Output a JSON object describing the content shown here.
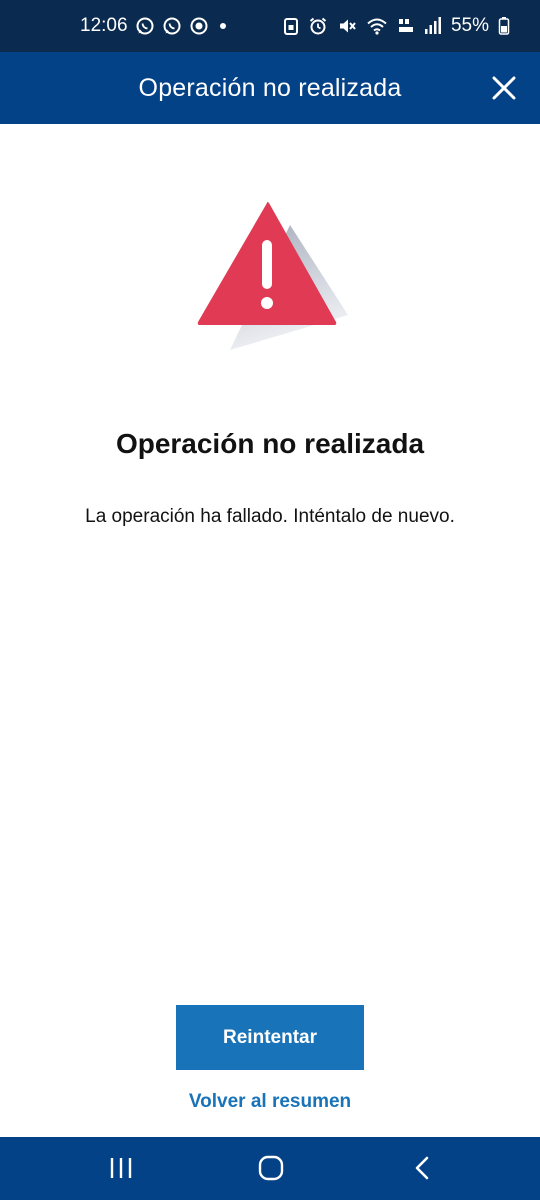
{
  "status_bar": {
    "time": "12:06",
    "battery": "55%",
    "left_icons": [
      "whatsapp-icon",
      "whatsapp-icon",
      "notification-app-icon",
      "dot-icon"
    ],
    "right_icons": [
      "sim-lock-icon",
      "alarm-icon",
      "mute-icon",
      "wifi-icon",
      "volte-icon",
      "signal-icon",
      "battery-icon"
    ]
  },
  "header": {
    "title": "Operación no realizada",
    "close_icon": "close-icon"
  },
  "content": {
    "illustration_icon": "warning-triangle-icon",
    "title": "Operación no realizada",
    "message": "La operación ha fallado. Inténtalo de nuevo."
  },
  "actions": {
    "retry_label": "Reintentar",
    "back_label": "Volver al resumen"
  },
  "nav_bar": {
    "icons": [
      "recent-apps-icon",
      "home-icon",
      "back-icon"
    ]
  },
  "colors": {
    "status_bar": "#0b2a4f",
    "header": "#044287",
    "warning_red": "#e03a55",
    "primary_button": "#1973b8",
    "link": "#1973b8",
    "text": "#121212"
  }
}
